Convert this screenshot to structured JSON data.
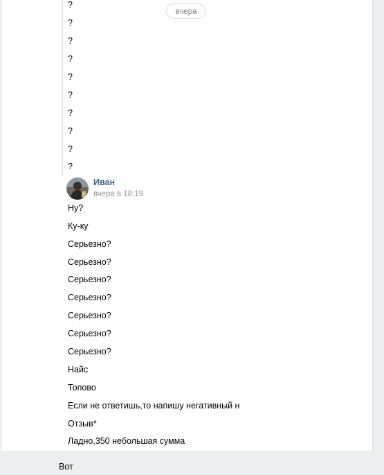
{
  "day_divider": "вчера",
  "quoted_questions": [
    "?",
    "?",
    "?",
    "?",
    "?",
    "?",
    "?",
    "?",
    "?",
    "?"
  ],
  "author": {
    "name": "Иван",
    "time": "вчера в 18:19",
    "avatar_icon": "user-avatar"
  },
  "messages": [
    "Ну?",
    "Ку-ку",
    "Серьезно?",
    "Серьезно?",
    "Серьезно?",
    "Серьезно?",
    "Серьезно?",
    "Серьезно?",
    "Серьезно?",
    "Найс",
    "Топово",
    "Если не ответишь,то напишу негативный н",
    "Отзыв*",
    "Ладно,350 небольшая сумма"
  ],
  "reply_text": "Вот"
}
